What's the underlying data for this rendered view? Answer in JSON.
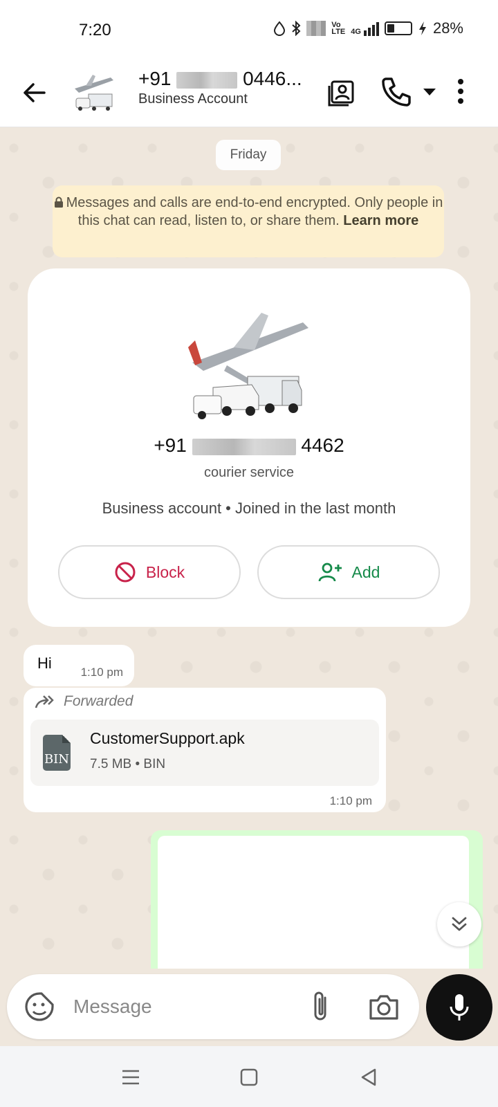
{
  "status_bar": {
    "time": "7:20",
    "network": "4G",
    "battery": "28%",
    "icons": [
      "water-drop-icon",
      "bluetooth-icon",
      "volte-icon",
      "signal-icon",
      "battery-icon",
      "charging-icon"
    ]
  },
  "header": {
    "title_prefix": "+91",
    "title_suffix": "0446...",
    "subtitle": "Business Account",
    "icons": [
      "back-arrow-icon",
      "contact-card-icon",
      "phone-icon",
      "dropdown-icon",
      "more-vert-icon"
    ]
  },
  "chat": {
    "day_label": "Friday",
    "encryption": {
      "text": "Messages and calls are end-to-end encrypted. Only people in this chat can read, listen to, or share them.",
      "link": "Learn more"
    },
    "profile": {
      "phone_prefix": "+91",
      "phone_suffix": "4462",
      "category": "courier service",
      "info": "Business account • Joined in the last month",
      "block_label": "Block",
      "add_label": "Add"
    },
    "messages": [
      {
        "text": "Hi",
        "time": "1:10 pm"
      },
      {
        "forwarded_label": "Forwarded",
        "file_name": "CustomerSupport.apk",
        "file_meta": "7.5 MB • BIN",
        "file_type": "BIN",
        "time": "1:10 pm"
      }
    ]
  },
  "input": {
    "placeholder": "Message"
  },
  "colors": {
    "chat_bg": "#efe7dd",
    "encrypt_bg": "#fdf0cf",
    "block_red": "#c8224a",
    "add_green": "#168a4a",
    "out_bubble": "#d8fdd2",
    "mic_bg": "#111111"
  }
}
